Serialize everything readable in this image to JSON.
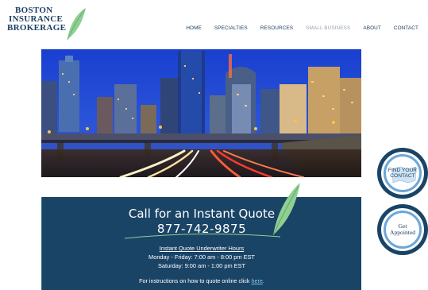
{
  "brand": {
    "line1": "BOSTON",
    "line2": "INSURANCE",
    "line3": "BROKERAGE",
    "color": "#1c3f63",
    "leaf_color": "#8fcf92"
  },
  "nav": {
    "items": [
      {
        "label": "HOME",
        "dim": false
      },
      {
        "label": "SPECIALTIES",
        "dim": false
      },
      {
        "label": "RESOURCES",
        "dim": false
      },
      {
        "label": "SMALL BUSINESS",
        "dim": true
      },
      {
        "label": "ABOUT",
        "dim": false
      },
      {
        "label": "CONTACT",
        "dim": false
      }
    ]
  },
  "quote": {
    "title": "Call for an Instant Quote",
    "phone": "877-742-9875",
    "hours_heading": "Instant Quote Underwriter Hours",
    "hours_weekday": "Monday - Friday: 7:00 am - 8:00 pm EST",
    "hours_saturday": "Saturday: 9:00 am - 1:00 pm EST",
    "instructions_prefix": "For instructions on how to quote online click ",
    "instructions_link": "here",
    "instructions_suffix": ".",
    "background": "#1a4466"
  },
  "side_buttons": {
    "find_line1": "FIND YOUR",
    "find_line2": "CONTACT",
    "get_line1": "Get",
    "get_line2": "Appointed"
  }
}
